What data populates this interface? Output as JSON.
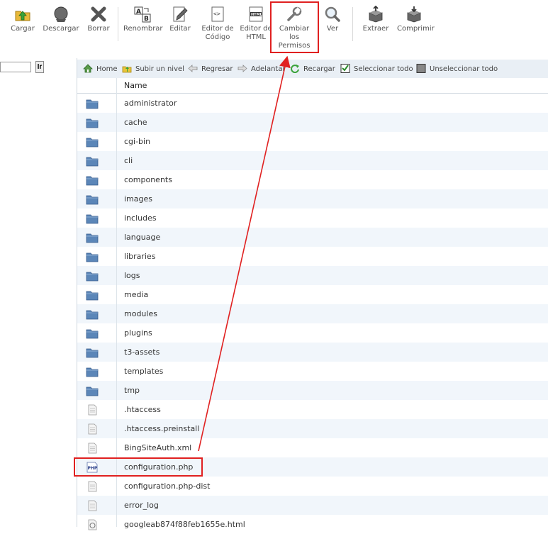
{
  "toolbar": {
    "cargar": "Cargar",
    "descargar": "Descargar",
    "borrar": "Borrar",
    "renombrar": "Renombrar",
    "editar": "Editar",
    "editor_codigo_1": "Editor de",
    "editor_codigo_2": "Código",
    "editor_html_1": "Editor de",
    "editor_html_2": "HTML",
    "permisos_1": "Cambiar",
    "permisos_2": "los",
    "permisos_3": "Permisos",
    "ver": "Ver",
    "extraer": "Extraer",
    "comprimir": "Comprimir"
  },
  "search": {
    "go_label": "Ir",
    "value": ""
  },
  "nav": {
    "home": "Home",
    "up": "Subir un nivel",
    "back": "Regresar",
    "forward": "Adelantar",
    "reload": "Recargar",
    "select_all": "Seleccionar todo",
    "unselect_all": "Unseleccionar todo"
  },
  "table": {
    "name_header": "Name",
    "rows": [
      {
        "name": "administrator",
        "type": "folder"
      },
      {
        "name": "cache",
        "type": "folder"
      },
      {
        "name": "cgi-bin",
        "type": "folder"
      },
      {
        "name": "cli",
        "type": "folder"
      },
      {
        "name": "components",
        "type": "folder"
      },
      {
        "name": "images",
        "type": "folder"
      },
      {
        "name": "includes",
        "type": "folder"
      },
      {
        "name": "language",
        "type": "folder"
      },
      {
        "name": "libraries",
        "type": "folder"
      },
      {
        "name": "logs",
        "type": "folder"
      },
      {
        "name": "media",
        "type": "folder"
      },
      {
        "name": "modules",
        "type": "folder"
      },
      {
        "name": "plugins",
        "type": "folder"
      },
      {
        "name": "t3-assets",
        "type": "folder"
      },
      {
        "name": "templates",
        "type": "folder"
      },
      {
        "name": "tmp",
        "type": "folder"
      },
      {
        "name": ".htaccess",
        "type": "file"
      },
      {
        "name": ".htaccess.preinstall",
        "type": "file"
      },
      {
        "name": "BingSiteAuth.xml",
        "type": "file"
      },
      {
        "name": "configuration.php",
        "type": "php"
      },
      {
        "name": "configuration.php-dist",
        "type": "file"
      },
      {
        "name": "error_log",
        "type": "file"
      },
      {
        "name": "googleab874f88feb1655e.html",
        "type": "html"
      }
    ]
  },
  "colors": {
    "highlight": "#e02020",
    "row_alt": "#f1f6fb",
    "folder": "#5b86b8"
  }
}
